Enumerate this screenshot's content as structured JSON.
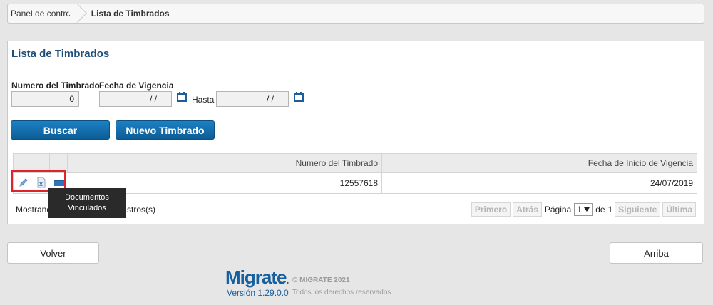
{
  "breadcrumb": {
    "home": "Panel de control",
    "current": "Lista de Timbrados"
  },
  "page": {
    "title": "Lista de Timbrados"
  },
  "filters": {
    "numero_label": "Numero del Timbrado",
    "numero_value": "0",
    "fecha_label": "Fecha de Vigencia",
    "fecha_desde_value": "/ /",
    "hasta_label": "Hasta",
    "fecha_hasta_value": "/ /"
  },
  "actions": {
    "buscar": "Buscar",
    "nuevo": "Nuevo Timbrado"
  },
  "grid": {
    "columns": [
      "Numero del Timbrado",
      "Fecha de Inicio de Vigencia"
    ],
    "rows": [
      {
        "numero": "12557618",
        "fecha": "24/07/2019"
      }
    ],
    "row_icons": [
      "pencil-icon",
      "excel-icon",
      "folder-icon"
    ]
  },
  "tooltip": {
    "line1": "Documentos",
    "line2": "Vinculados"
  },
  "records": {
    "text_start": "Mostrand",
    "text_end": "stros(s)"
  },
  "pager": {
    "first": "Primero",
    "back": "Atrás",
    "page_label": "Página",
    "page_value": "1",
    "of_label": "de",
    "total_pages": "1",
    "next": "Siguiente",
    "last": "Última"
  },
  "footer": {
    "volver": "Volver",
    "arriba": "Arriba",
    "logo": "Migrate",
    "version": "Versión  1.29.0.0",
    "copyright": "© MIGRATE 2021",
    "rights": "Todos los derechos reservados"
  },
  "colors": {
    "accent": "#0e5d96",
    "title": "#1f4e79",
    "highlight_border": "#e0232b"
  }
}
